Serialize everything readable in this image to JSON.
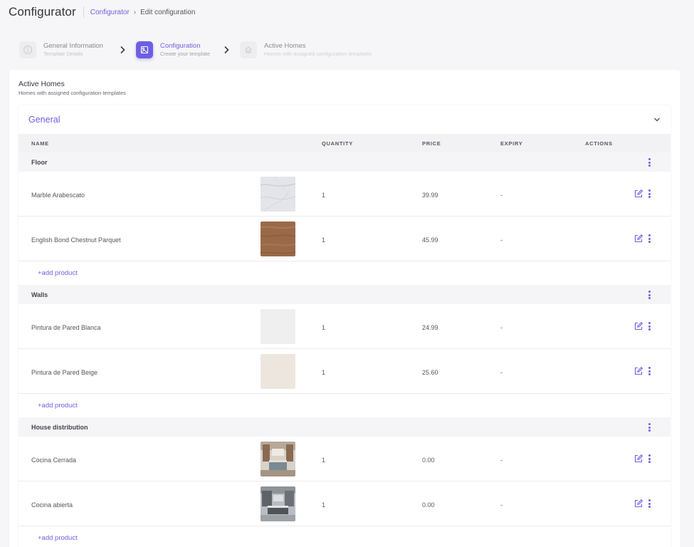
{
  "header": {
    "title": "Configurator",
    "breadcrumb": {
      "parent": "Configurator",
      "separator": "›",
      "current": "Edit configuration"
    }
  },
  "stepper": {
    "steps": [
      {
        "title": "General Information",
        "subtitle": "Template Details",
        "icon": "info-icon",
        "state": "done"
      },
      {
        "title": "Configuration",
        "subtitle": "Create your template",
        "icon": "configuration-icon",
        "state": "current"
      },
      {
        "title": "Active Homes",
        "subtitle": "Homes with assigned configuration templates",
        "icon": "home-icon",
        "state": "future"
      }
    ]
  },
  "card": {
    "title": "Active Homes",
    "subtitle": "Homes with assigned configuration templates"
  },
  "section": {
    "title": "General",
    "columns": {
      "name": "NAME",
      "quantity": "QUANTITY",
      "price": "PRICE",
      "expiry": "EXPIRY",
      "actions": "ACTIONS"
    },
    "add_label": "+add product",
    "groups": [
      {
        "name": "Floor",
        "products": [
          {
            "name": "Marble Arabescato",
            "quantity": "1",
            "price": "39.99",
            "expiry": "-",
            "swatch": "marble"
          },
          {
            "name": "English Bond Chestnut Parquet",
            "quantity": "1",
            "price": "45.99",
            "expiry": "-",
            "swatch": "wood"
          }
        ]
      },
      {
        "name": "Walls",
        "products": [
          {
            "name": "Pintura de Pared Blanca",
            "quantity": "1",
            "price": "24.99",
            "expiry": "-",
            "swatch": "white"
          },
          {
            "name": "Pintura de Pared Beige",
            "quantity": "1",
            "price": "25.60",
            "expiry": "-",
            "swatch": "beige"
          }
        ]
      },
      {
        "name": "House distribution",
        "products": [
          {
            "name": "Cocina Cerrada",
            "quantity": "1",
            "price": "0.00",
            "expiry": "-",
            "swatch": "kitchen-warm"
          },
          {
            "name": "Cocina abierta",
            "quantity": "1",
            "price": "0.00",
            "expiry": "-",
            "swatch": "kitchen-grey"
          }
        ]
      }
    ]
  },
  "colors": {
    "accent": "#6e5fe4",
    "background": "#f6f6f8",
    "swatch_white": "#efefef",
    "swatch_beige": "#ece6df"
  }
}
